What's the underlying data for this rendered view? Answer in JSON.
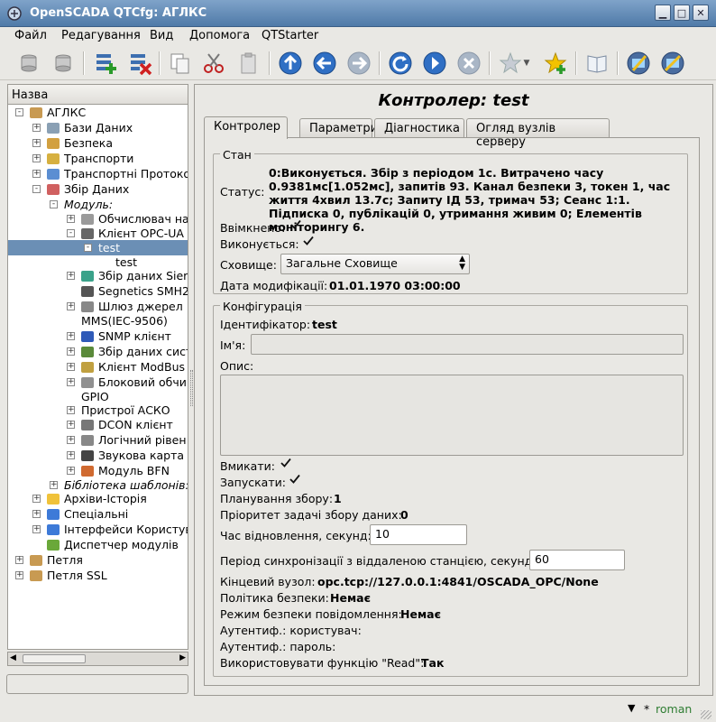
{
  "window": {
    "title": "OpenSCADA QTCfg: АГЛКС"
  },
  "menu": [
    {
      "label": "Файл"
    },
    {
      "label": "Редагування"
    },
    {
      "label": "Вид"
    },
    {
      "label": "Допомога"
    },
    {
      "label": "QTStarter"
    }
  ],
  "toolbar": {
    "icons": [
      "db-load-icon",
      "db-save-icon",
      "add-item-icon",
      "delete-item-icon",
      "copy-icon",
      "cut-icon",
      "paste-icon",
      "up-icon",
      "back-icon",
      "forward-icon",
      "refresh-icon",
      "start-icon",
      "stop-icon",
      "favorite-icon",
      "add-favorite-icon",
      "manual-icon",
      "manual-page-icon",
      "settings-icon"
    ]
  },
  "tree": {
    "header": "Назва",
    "items": [
      {
        "label": "АГЛКС"
      },
      {
        "label": "Бази Даних"
      },
      {
        "label": "Безпека"
      },
      {
        "label": "Транспорти"
      },
      {
        "label": "Транспортні Протоко"
      },
      {
        "label": "Збір Даних"
      },
      {
        "label": "Модуль:"
      },
      {
        "label": "Обчислювач на"
      },
      {
        "label": "Клієнт OPC-UA"
      },
      {
        "label": "test"
      },
      {
        "label": "test"
      },
      {
        "label": "Збір даних Sier"
      },
      {
        "label": "Segnetics SMH2"
      },
      {
        "label": "Шлюз джерел"
      },
      {
        "label": "MMS(IEC-9506)"
      },
      {
        "label": "SNMP клієнт"
      },
      {
        "label": "Збір даних сист"
      },
      {
        "label": "Клієнт ModBus"
      },
      {
        "label": "Блоковий обчи"
      },
      {
        "label": "GPIO"
      },
      {
        "label": "Пристрої АСКО"
      },
      {
        "label": "DCON клієнт"
      },
      {
        "label": "Логічний рівен"
      },
      {
        "label": "Звукова карта"
      },
      {
        "label": "Модуль BFN"
      },
      {
        "label": "Бібліотека шаблонів:"
      },
      {
        "label": "Архіви-Історія"
      },
      {
        "label": "Спеціальні"
      },
      {
        "label": "Інтерфейси Користув"
      },
      {
        "label": "Диспетчер модулів"
      },
      {
        "label": "Петля"
      },
      {
        "label": "Петля SSL"
      }
    ]
  },
  "page": {
    "title": "Контролер: test",
    "tabs": [
      {
        "label": "Контролер"
      },
      {
        "label": "Параметри"
      },
      {
        "label": "Діагностика"
      },
      {
        "label": "Огляд вузлів серверу"
      }
    ],
    "state": {
      "legend": "Стан",
      "status_label": "Статус:",
      "status_value": "0:Виконується. Збір з періодом 1с. Витрачено часу 0.9381мс[1.052мс], запитів 93. Канал безпеки 3, токен 1, час життя 4хвил 13.7с; Запиту ІД 53, тримач 53; Сеанс 1:1. Підписка 0, публікацій 0, утримання живим 0; Елементів моніторингу 6.",
      "enabled_label": "Ввімкнено:",
      "enabled": true,
      "running_label": "Виконується:",
      "running": true,
      "storage_label": "Сховище:",
      "storage_value": "Загальне Сховище",
      "modified_label": "Дата модифікації:",
      "modified_value": "01.01.1970 03:00:00"
    },
    "config": {
      "legend": "Конфігурація",
      "id_label": "Ідентифікатор:",
      "id_value": "test",
      "name_label": "Ім'я:",
      "name_value": "",
      "descr_label": "Опис:",
      "descr_value": "",
      "enable_label": "Вмикати:",
      "enable": true,
      "start_label": "Запускати:",
      "start": true,
      "schedule_label": "Планування збору:",
      "schedule_value": "1",
      "priority_label": "Пріоритет задачі збору даних:",
      "priority_value": "0",
      "restore_label": "Час відновлення, секунд:",
      "restore_value": "10",
      "sync_label": "Період синхронізації з віддаленою станцією, секунд:",
      "sync_value": "60",
      "endpoint_label": "Кінцевий вузол:",
      "endpoint_value": "opc.tcp://127.0.0.1:4841/OSCADA_OPC/None",
      "secpolicy_label": "Політика безпеки:",
      "secpolicy_value": "Немає",
      "secmode_label": "Режим безпеки повідомлення:",
      "secmode_value": "Немає",
      "authuser_label": "Аутентиф.: користувач:",
      "authuser_value": "",
      "authpass_label": "Аутентиф.: пароль:",
      "authpass_value": "",
      "useread_label": "Використовувати функцію \"Read\":",
      "useread_value": "Так"
    }
  },
  "statusbar": {
    "modified_mark": "*",
    "user": "roman"
  },
  "colors": {
    "accent": "#6b8fb5",
    "titlebar": "#5d87b5",
    "user": "#2e7d32"
  }
}
